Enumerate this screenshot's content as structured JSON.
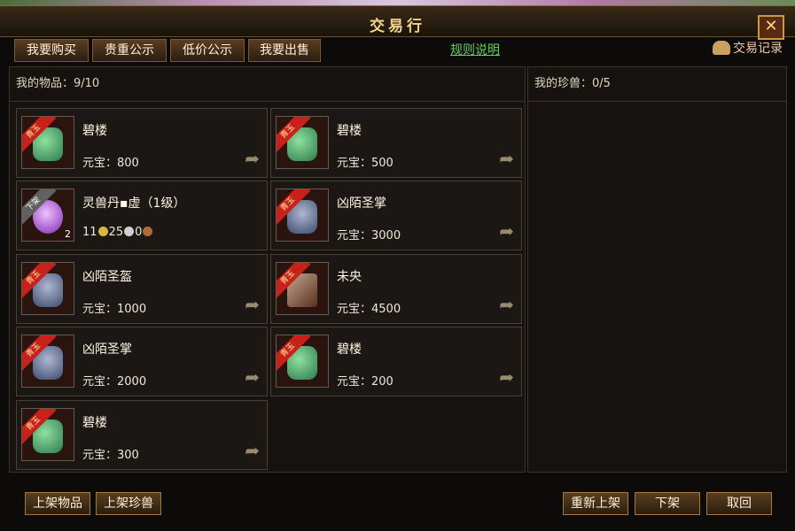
{
  "window": {
    "title": "交易行",
    "close_label": "✕"
  },
  "tabs": [
    {
      "label": "我要购买"
    },
    {
      "label": "贵重公示"
    },
    {
      "label": "低价公示"
    },
    {
      "label": "我要出售"
    }
  ],
  "rules_link": "规则说明",
  "record_link": "交易记录",
  "left_panel": {
    "header": "我的物品：9/10"
  },
  "right_panel": {
    "header": "我的珍兽：0/5"
  },
  "items": [
    {
      "name": "碧楼",
      "price": "元宝：800",
      "badge": "青玉",
      "icon": "jade-pendant-icon"
    },
    {
      "name": "碧楼",
      "price": "元宝：500",
      "badge": "青玉",
      "icon": "jade-pendant-icon"
    },
    {
      "name": "灵兽丹▪虚（1级）",
      "badge": "下架",
      "icon": "purple-orb-icon",
      "quantity": "2",
      "coins": {
        "gold": "11",
        "silver": "25",
        "copper": "0"
      }
    },
    {
      "name": "凶陌圣掌",
      "price": "元宝：3000",
      "badge": "青玉",
      "icon": "gauntlet-icon"
    },
    {
      "name": "凶陌圣盔",
      "price": "元宝：1000",
      "badge": "青玉",
      "icon": "gauntlet-icon"
    },
    {
      "name": "未央",
      "price": "元宝：4500",
      "badge": "青玉",
      "icon": "blade-icon"
    },
    {
      "name": "凶陌圣掌",
      "price": "元宝：2000",
      "badge": "青玉",
      "icon": "gauntlet-icon"
    },
    {
      "name": "碧楼",
      "price": "元宝：200",
      "badge": "青玉",
      "icon": "jade-pendant-icon"
    },
    {
      "name": "碧楼",
      "price": "元宝：300",
      "badge": "青玉",
      "icon": "jade-pendant-icon"
    }
  ],
  "buttons": {
    "list_item": "上架物品",
    "list_pet": "上架珍兽",
    "relist": "重新上架",
    "delist": "下架",
    "cancel": "取回"
  },
  "colors": {
    "accent": "#f4d48a",
    "link": "#5fd060",
    "ribbon_red": "#c8201a"
  }
}
